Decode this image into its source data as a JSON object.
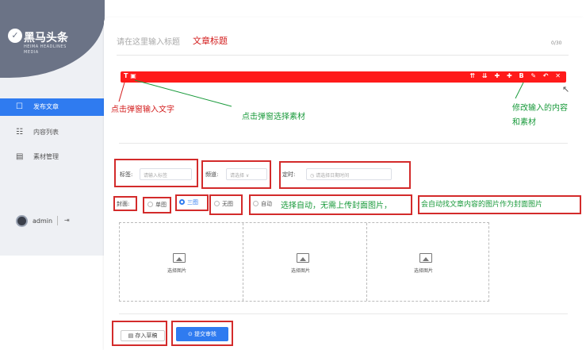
{
  "brand": {
    "logo_glyph": "✓",
    "title": "黑马头条",
    "subtitle_line1": "HEIMA HEADLINES",
    "subtitle_line2": "MEDIA"
  },
  "sidebar": {
    "items": [
      {
        "icon": "☐",
        "label": "发布文章",
        "active": true
      },
      {
        "icon": "☷",
        "label": "内容列表",
        "active": false
      },
      {
        "icon": "▤",
        "label": "素材管理",
        "active": false
      }
    ],
    "user": {
      "name": "admin",
      "separator": "|",
      "logout_glyph": "⇥"
    }
  },
  "editor": {
    "title_placeholder": "请在这里输入标题",
    "title_annotation": "文章标题",
    "counter": "0/30",
    "toolbar_left": "T  ▣",
    "toolbar_right": "⇈ ⇊ ✚ ✚ B ✎ ↶ ✕",
    "cursor_glyph": "↖"
  },
  "annotations": {
    "popup_text": "点击弹窗输入文字",
    "popup_material": "点击弹窗选择素材",
    "modify_line1": "修改输入的内容",
    "modify_line2": "和素材",
    "auto_cover": "选择自动，无需上传封面图片，",
    "auto_cover_tail": "会自动找文章内容的图片作为封面图片"
  },
  "form": {
    "tag_label": "标签:",
    "tag_placeholder": "请输入标签",
    "channel_label": "频道:",
    "channel_placeholder": "请选择 ∨",
    "schedule_label": "定时:",
    "schedule_placeholder": "◷  请选择日期时间",
    "cover_label": "封面:",
    "cover_options": [
      {
        "label": "单图",
        "selected": false
      },
      {
        "label": "三图",
        "selected": true
      },
      {
        "label": "无图",
        "selected": false
      },
      {
        "label": "自动",
        "selected": false
      }
    ]
  },
  "upload": {
    "slots": [
      "选择图片",
      "选择图片",
      "选择图片"
    ]
  },
  "actions": {
    "save_draft": "▤ 存入草稿",
    "submit": "⊙ 提交审核"
  },
  "colors": {
    "accent": "#2f7bf0",
    "toolbar": "#ff1a1a",
    "annotation_red": "#d31c1c",
    "annotation_green": "#199a3b",
    "sidebar_header": "#6b7386"
  }
}
